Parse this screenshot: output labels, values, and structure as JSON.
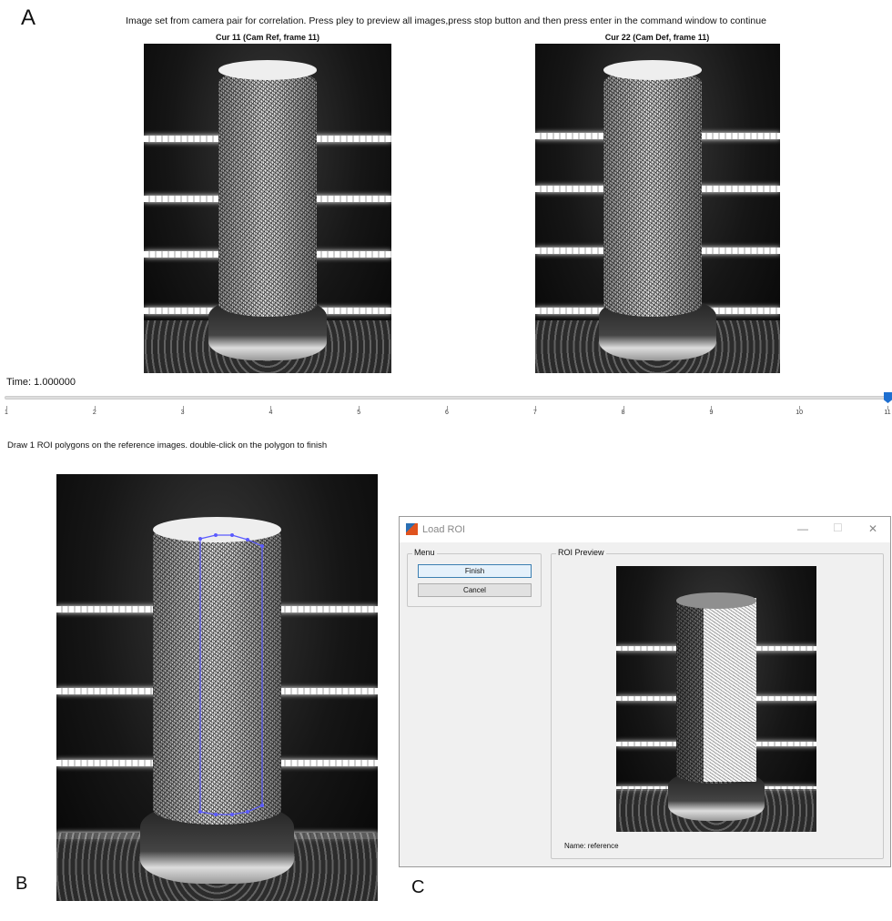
{
  "panel_a": {
    "letter": "A",
    "instruction": "Image set from camera pair for correlation. Press pley to preview all images,press stop button and then press enter in the command window to continue",
    "images": [
      {
        "title": "Cur 11 (Cam Ref, frame 11)"
      },
      {
        "title": "Cur 22 (Cam Def, frame 11)"
      }
    ],
    "time_label": "Time: 1.000000",
    "slider": {
      "min": 1,
      "max": 11,
      "value": 11,
      "ticks": [
        "1",
        "2",
        "3",
        "4",
        "5",
        "6",
        "7",
        "8",
        "9",
        "10",
        "11"
      ],
      "thumb_color": "#1e6fd0"
    }
  },
  "panel_b": {
    "letter": "B",
    "instruction": "Draw 1 ROI polygons on the reference images. double-click on the polygon to finish",
    "polygon_color": "#5b5bff"
  },
  "panel_c": {
    "letter": "C",
    "dialog": {
      "title": "Load ROI",
      "minimize": "—",
      "maximize": "☐",
      "close": "✕",
      "menu_group": "Menu",
      "finish": "Finish",
      "cancel": "Cancel",
      "preview_group": "ROI Preview",
      "name_label": "Name: reference"
    }
  }
}
